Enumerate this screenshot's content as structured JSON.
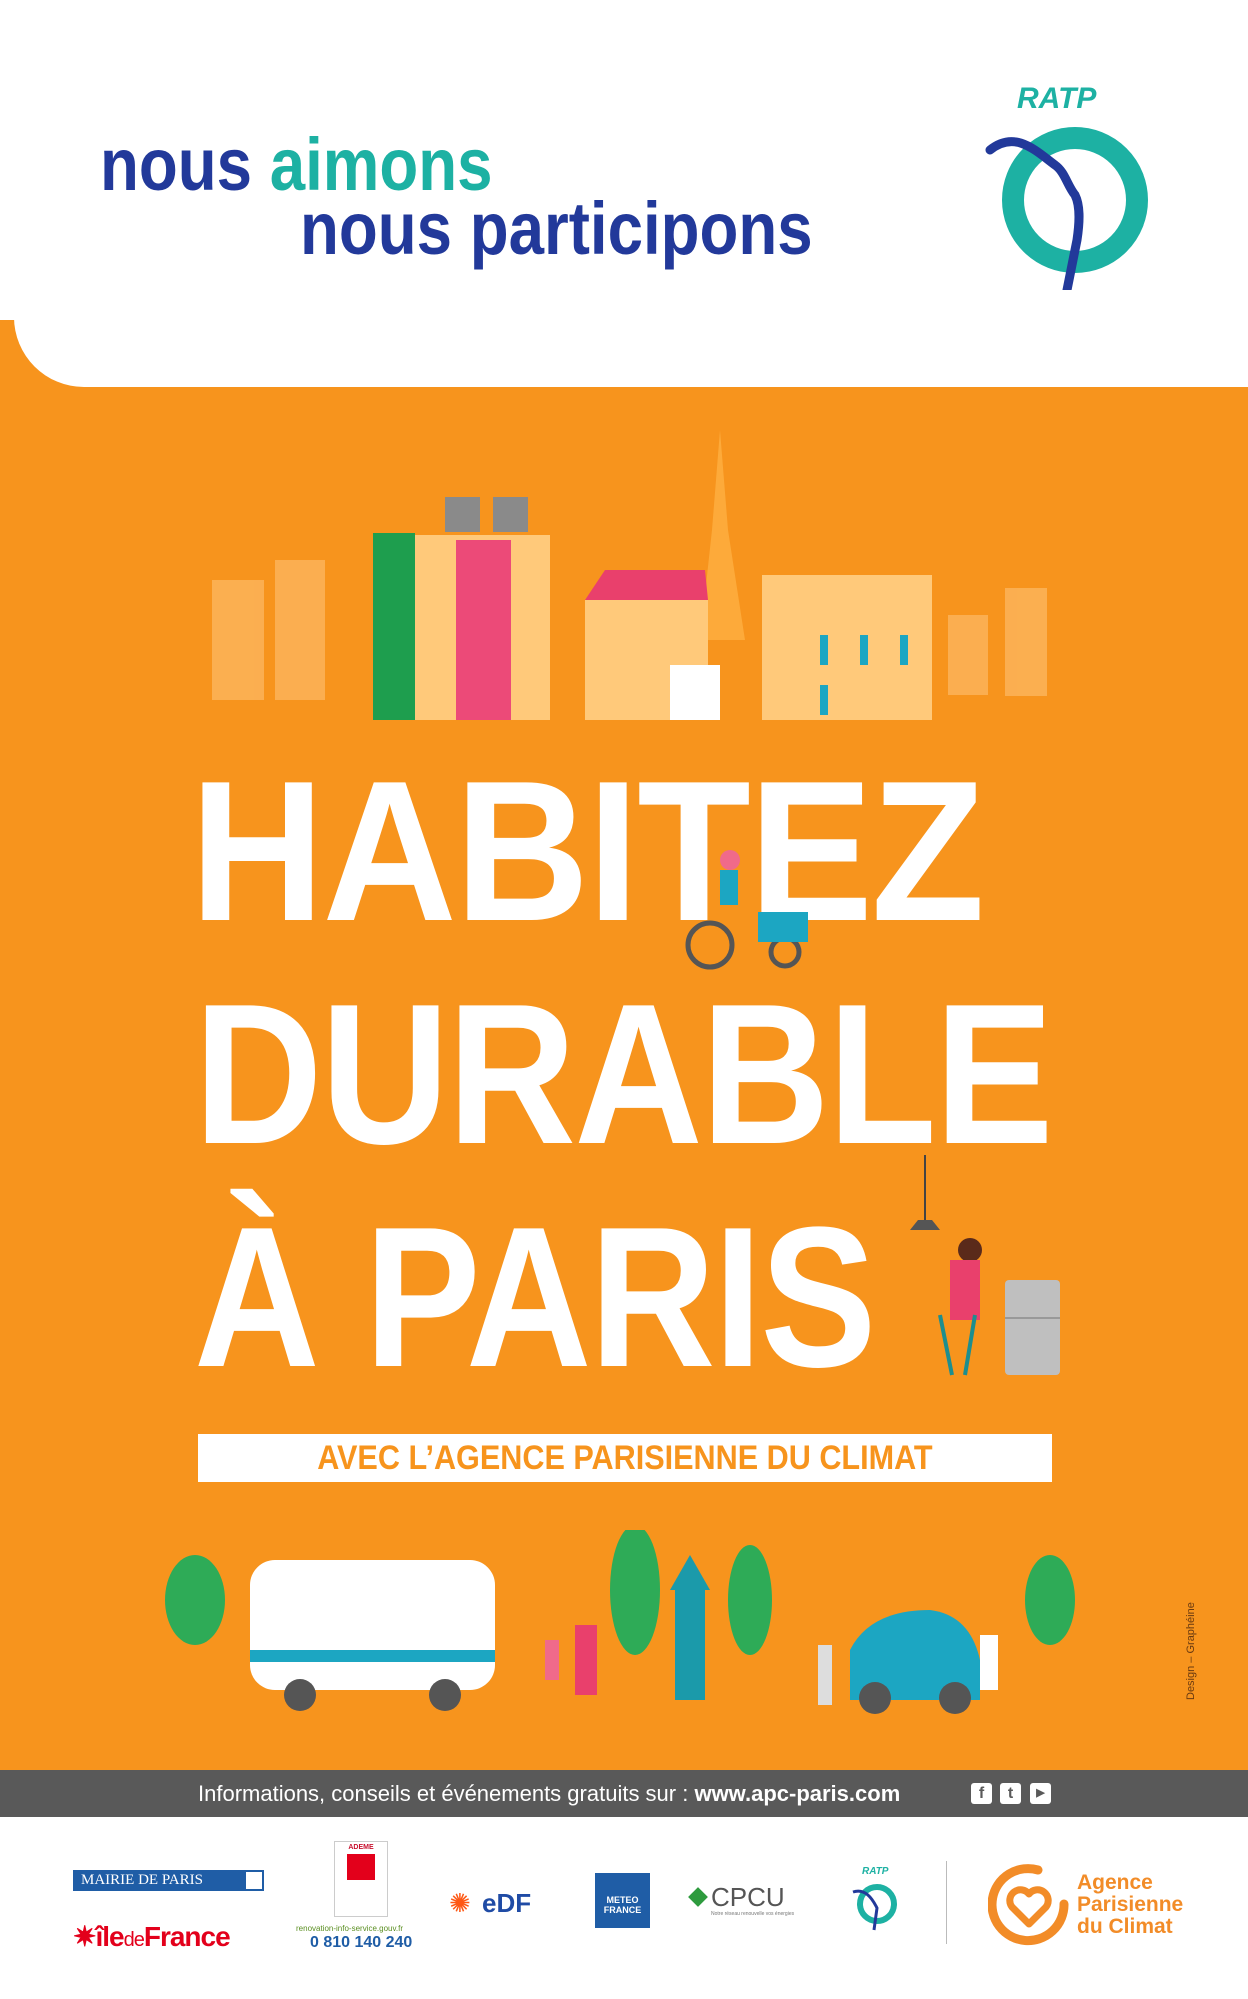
{
  "header": {
    "line1_a": "nous",
    "line1_b": "aimons",
    "line2": "nous participons",
    "ratp_logo": "RATP"
  },
  "headline": {
    "line1": "HABITEZ",
    "line2": "DURABLE",
    "line3": "À PARIS"
  },
  "banner": "AVEC L’AGENCE PARISIENNE DU CLIMAT",
  "credit": "Design – Graphéine",
  "infobar": {
    "text": "Informations, conseils et événements gratuits sur : ",
    "url": "www.apc-paris.com",
    "social_icons": [
      "f",
      "t",
      "▶"
    ]
  },
  "partners": {
    "mairie": "MAIRIE DE PARIS",
    "idf_a": "île",
    "idf_b": "de",
    "idf_c": "France",
    "ademe": "ADEME",
    "reno_site": "renovation-info-service.gouv.fr",
    "reno_phone": "0 810 140 240",
    "edf": "eDF",
    "meteo_1": "METEO",
    "meteo_2": "FRANCE",
    "cpcu": "CPCU",
    "cpcu_tag": "Notre réseau renouvelle vos énergies",
    "ratp": "RATP",
    "apc_1": "Agence",
    "apc_2": "Parisienne",
    "apc_3": "du Climat"
  },
  "colors": {
    "orange": "#F7941D",
    "navy": "#22399A",
    "teal": "#1DB1A3",
    "grey": "#595959"
  }
}
